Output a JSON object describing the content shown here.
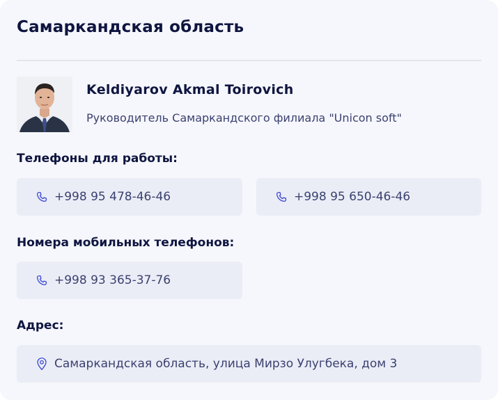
{
  "region": {
    "title": "Самаркандская область"
  },
  "person": {
    "name": "Keldiyarov Akmal Toirovich",
    "role": "Руководитель Самаркандского филиала \"Unicon soft\""
  },
  "work_phones": {
    "label": "Телефоны для работы:",
    "items": [
      "+998 95 478-46-46",
      "+998 95 650-46-46"
    ]
  },
  "mobile_phones": {
    "label": "Номера мобильных телефонов:",
    "items": [
      "+998 93 365-37-76"
    ]
  },
  "address": {
    "label": "Адрес:",
    "value": "Самаркандская область, улица Мирзо Улугбека, дом 3"
  },
  "colors": {
    "background": "#f6f7fc",
    "chip": "#ebedf6",
    "title": "#0f1540",
    "text": "#3b4170",
    "icon": "#3f4bd6"
  },
  "icons": {
    "phone": "phone-icon",
    "location": "location-pin-icon"
  }
}
